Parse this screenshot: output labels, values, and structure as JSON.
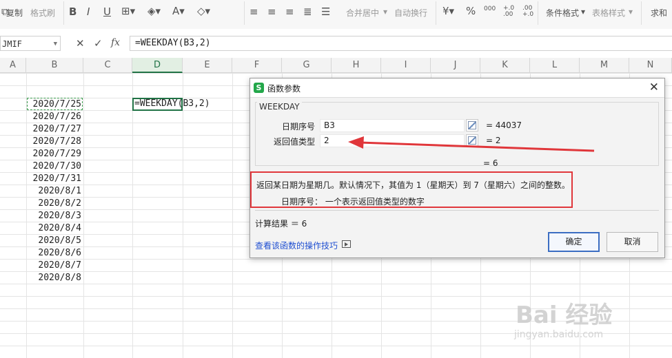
{
  "ribbon": {
    "copy": "复制",
    "format_painter": "格式刷",
    "merge_center": "合并居中",
    "auto_wrap": "自动换行",
    "conditional_format": "条件格式",
    "table_style": "表格样式",
    "sum": "求和",
    "percent": "%",
    "thousands": "000",
    "inc_decimal": "+.0 .00",
    "dec_decimal": ".00 +.0"
  },
  "formula_bar": {
    "name_box": "JMIF",
    "formula": "=WEEKDAY(B3,2)",
    "fx": "fx"
  },
  "columns": [
    "A",
    "B",
    "C",
    "D",
    "E",
    "F",
    "G",
    "H",
    "I",
    "J",
    "K",
    "L",
    "M",
    "N"
  ],
  "active_column": "D",
  "dates": [
    "2020/7/25",
    "2020/7/26",
    "2020/7/27",
    "2020/7/28",
    "2020/7/29",
    "2020/7/30",
    "2020/7/31",
    "2020/8/1",
    "2020/8/2",
    "2020/8/3",
    "2020/8/4",
    "2020/8/5",
    "2020/8/6",
    "2020/8/7",
    "2020/8/8"
  ],
  "d3_formula": "=WEEKDAY(B3,2)",
  "dialog": {
    "title": "函数参数",
    "function_name": "WEEKDAY",
    "args": [
      {
        "label": "日期序号",
        "value": "B3",
        "result": "= 44037"
      },
      {
        "label": "返回值类型",
        "value": "2",
        "result": "= 2"
      }
    ],
    "total_result": "= 6",
    "description": "返回某日期为星期几。默认情况下，其值为 1（星期天）到 7（星期六）之间的整数。",
    "param_description": "日期序号：  一个表示返回值类型的数字",
    "calc_result": "计算结果 ＝ 6",
    "help_link": "查看该函数的操作技巧",
    "ok": "确定",
    "cancel": "取消"
  },
  "colors": {
    "accent_green": "#217346",
    "annotation_red": "#e0363a",
    "link_blue": "#1f4fd1"
  },
  "watermark": {
    "main": "Bai 经验",
    "sub": "jingyan.baidu.com"
  }
}
